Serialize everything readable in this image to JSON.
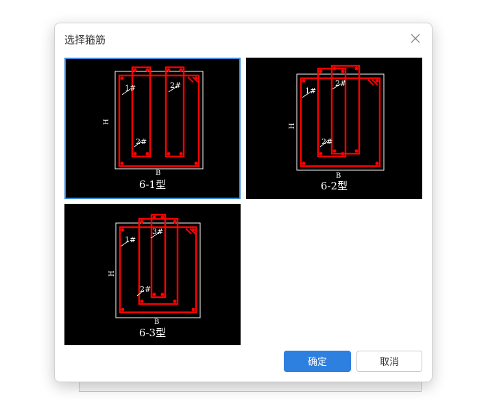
{
  "dialog": {
    "title": "选择箍筋",
    "ok_label": "确定",
    "cancel_label": "取消"
  },
  "options": [
    {
      "label": "6-1型",
      "selected": true,
      "marks": [
        "1#",
        "2#",
        "2#"
      ],
      "dim_h": "H",
      "dim_b": "B"
    },
    {
      "label": "6-2型",
      "selected": false,
      "marks": [
        "1#",
        "2#",
        "2#"
      ],
      "dim_h": "H",
      "dim_b": "B"
    },
    {
      "label": "6-3型",
      "selected": false,
      "marks": [
        "1#",
        "3#",
        "2#"
      ],
      "dim_h": "H",
      "dim_b": "B"
    }
  ],
  "colors": {
    "accent": "#2d7fe0",
    "rebar": "#ff0000",
    "outline": "#ffffff",
    "canvas": "#000000"
  }
}
